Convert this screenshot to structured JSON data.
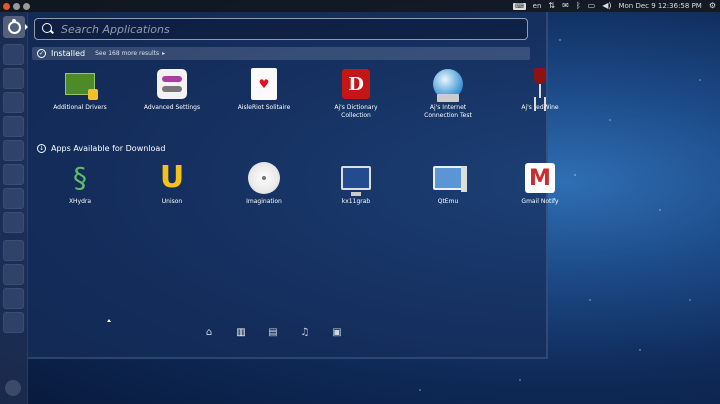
{
  "top_panel": {
    "keyboard": "en",
    "clock": "Mon Dec  9 12:36:58 PM"
  },
  "search": {
    "placeholder": "Search Applications",
    "value": ""
  },
  "installed": {
    "title": "Installed",
    "see_more": "See 168 more results",
    "apps": [
      {
        "label": "Additional Drivers",
        "icon": "drivers-icon"
      },
      {
        "label": "Advanced Settings",
        "icon": "settings-toggle-icon"
      },
      {
        "label": "AisleRiot Solitaire",
        "icon": "playing-card-icon"
      },
      {
        "label": "Aj's Dictionary\nCollection",
        "icon": "dictionary-icon"
      },
      {
        "label": "Aj's Internet\nConnection Test",
        "icon": "network-globe-icon"
      },
      {
        "label": "Aj's redWine",
        "icon": "wine-glass-icon"
      }
    ]
  },
  "download": {
    "title": "Apps Available for Download",
    "apps": [
      {
        "label": "XHydra",
        "icon": "hydra-icon"
      },
      {
        "label": "Unison",
        "icon": "unison-icon"
      },
      {
        "label": "Imagination",
        "icon": "disc-icon"
      },
      {
        "label": "kx11grab",
        "icon": "monitor-icon"
      },
      {
        "label": "QtEmu",
        "icon": "computer-icon"
      },
      {
        "label": "Gmail Notify",
        "icon": "gmail-icon"
      }
    ]
  },
  "lenses": [
    {
      "name": "home",
      "glyph": "⌂"
    },
    {
      "name": "applications",
      "glyph": "▥"
    },
    {
      "name": "files",
      "glyph": "▤"
    },
    {
      "name": "music",
      "glyph": "♫"
    },
    {
      "name": "video",
      "glyph": "▣"
    }
  ],
  "colors": {
    "dash_bg": "#162e5c",
    "close_button": "#e2582d"
  }
}
